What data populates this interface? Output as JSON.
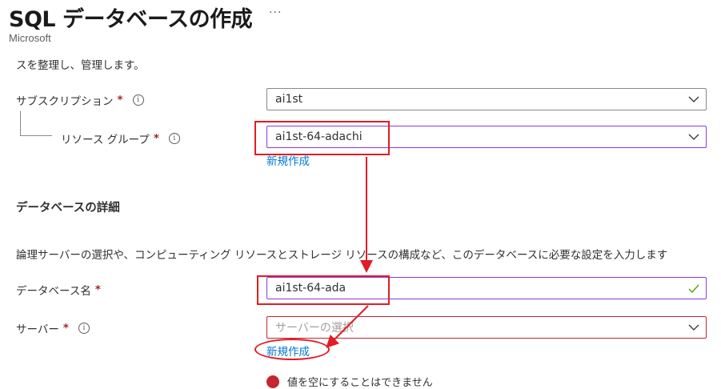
{
  "header": {
    "title": "SQL データベースの作成",
    "ellipsis": "···",
    "publisher": "Microsoft"
  },
  "intro_text": "スを整理し、管理します。",
  "subscription": {
    "label": "サブスクリプション",
    "required_mark": "*",
    "info_glyph": "i",
    "value": "ai1st"
  },
  "resource_group": {
    "label": "リソース グループ",
    "required_mark": "*",
    "info_glyph": "i",
    "value": "ai1st-64-adachi",
    "create_new_link": "新規作成"
  },
  "database_details": {
    "heading": "データベースの詳細",
    "description": "論理サーバーの選択や、コンピューティング リソースとストレージ リソースの構成など、このデータベースに必要な設定を入力します"
  },
  "database_name": {
    "label": "データベース名",
    "required_mark": "*",
    "value": "ai1st-64-ada",
    "valid_icon": "checkmark-icon"
  },
  "server": {
    "label": "サーバー",
    "required_mark": "*",
    "info_glyph": "i",
    "placeholder": "サーバーの選択",
    "create_new_link": "新規作成",
    "error_text": "値を空にすることはできません"
  },
  "colors": {
    "accent_link": "#0078d4",
    "required": "#a4262c",
    "annotation_red": "#e11c26",
    "focus_purple": "#8a3bd9",
    "valid_green": "#57a300"
  }
}
